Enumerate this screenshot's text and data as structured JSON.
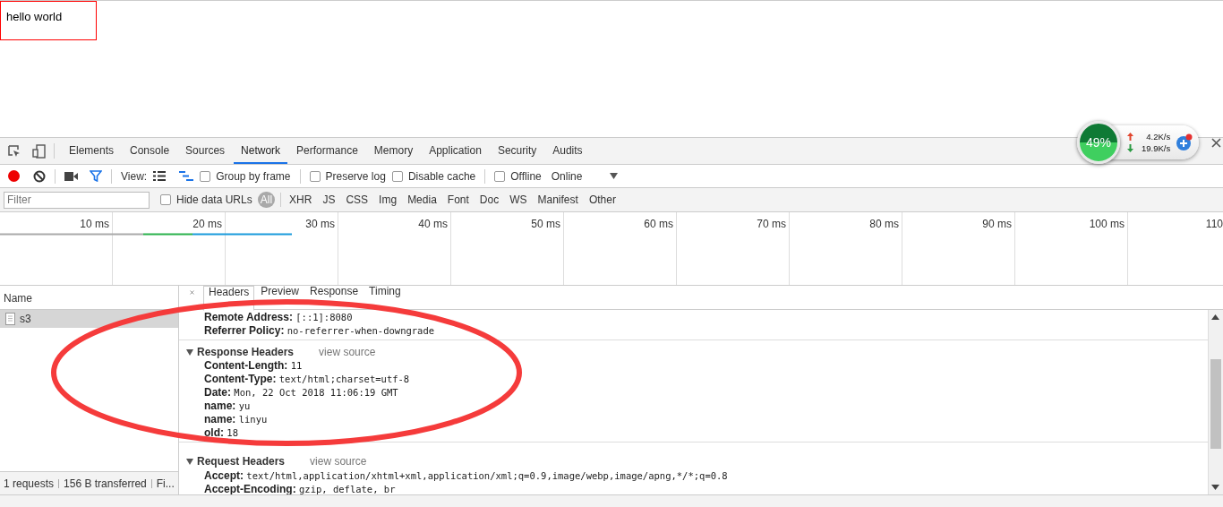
{
  "page": {
    "text": "hello world"
  },
  "devtools": {
    "tabs": [
      {
        "label": "Elements",
        "selected": false
      },
      {
        "label": "Console",
        "selected": false
      },
      {
        "label": "Sources",
        "selected": false
      },
      {
        "label": "Network",
        "selected": true
      },
      {
        "label": "Performance",
        "selected": false
      },
      {
        "label": "Memory",
        "selected": false
      },
      {
        "label": "Application",
        "selected": false
      },
      {
        "label": "Security",
        "selected": false
      },
      {
        "label": "Audits",
        "selected": false
      }
    ],
    "toolbar": {
      "recording": true,
      "view_label": "View:",
      "options": [
        {
          "label": "Group by frame",
          "checked": false
        },
        {
          "label": "Preserve log",
          "checked": false
        },
        {
          "label": "Disable cache",
          "checked": false
        },
        {
          "label": "Offline",
          "checked": false
        }
      ],
      "throttling": "Online"
    },
    "filter": {
      "placeholder": "Filter",
      "hide_data_urls": {
        "label": "Hide data URLs",
        "checked": false
      },
      "types": [
        {
          "label": "All",
          "selected": true
        },
        {
          "label": "XHR",
          "selected": false
        },
        {
          "label": "JS",
          "selected": false
        },
        {
          "label": "CSS",
          "selected": false
        },
        {
          "label": "Img",
          "selected": false
        },
        {
          "label": "Media",
          "selected": false
        },
        {
          "label": "Font",
          "selected": false
        },
        {
          "label": "Doc",
          "selected": false
        },
        {
          "label": "WS",
          "selected": false
        },
        {
          "label": "Manifest",
          "selected": false
        },
        {
          "label": "Other",
          "selected": false
        }
      ]
    },
    "overview": {
      "ticks": [
        "10 ms",
        "20 ms",
        "30 ms",
        "40 ms",
        "50 ms",
        "60 ms",
        "70 ms",
        "80 ms",
        "90 ms",
        "100 ms",
        "110"
      ]
    },
    "requests": {
      "column": "Name",
      "rows": [
        {
          "name": "s3",
          "selected": true
        }
      ],
      "summary": [
        "1 requests",
        "156 B transferred",
        "Fi..."
      ]
    },
    "details": {
      "tabs": [
        {
          "label": "Headers",
          "selected": true
        },
        {
          "label": "Preview",
          "selected": false
        },
        {
          "label": "Response",
          "selected": false
        },
        {
          "label": "Timing",
          "selected": false
        }
      ],
      "sections": [
        {
          "kind": "fields",
          "items": [
            {
              "key": "Remote Address:",
              "value": "[::1]:8080"
            },
            {
              "key": "Referrer Policy:",
              "value": "no-referrer-when-downgrade"
            }
          ]
        },
        {
          "kind": "group",
          "title": "Response Headers",
          "link": "view source",
          "expanded": true,
          "items": [
            {
              "key": "Content-Length:",
              "value": "11"
            },
            {
              "key": "Content-Type:",
              "value": "text/html;charset=utf-8"
            },
            {
              "key": "Date:",
              "value": "Mon, 22 Oct 2018 11:06:19 GMT"
            },
            {
              "key": "name:",
              "value": "yu"
            },
            {
              "key": "name:",
              "value": "linyu"
            },
            {
              "key": "old:",
              "value": "18"
            }
          ]
        },
        {
          "kind": "group",
          "title": "Request Headers",
          "link": "view source",
          "expanded": true,
          "items": [
            {
              "key": "Accept:",
              "value": "text/html,application/xhtml+xml,application/xml;q=0.9,image/webp,image/apng,*/*;q=0.8"
            },
            {
              "key": "Accept-Encoding:",
              "value": "gzip, deflate, br"
            }
          ]
        }
      ]
    }
  },
  "speed_widget": {
    "cpu": "49%",
    "upload": "4.2K/s",
    "download": "19.9K/s"
  }
}
